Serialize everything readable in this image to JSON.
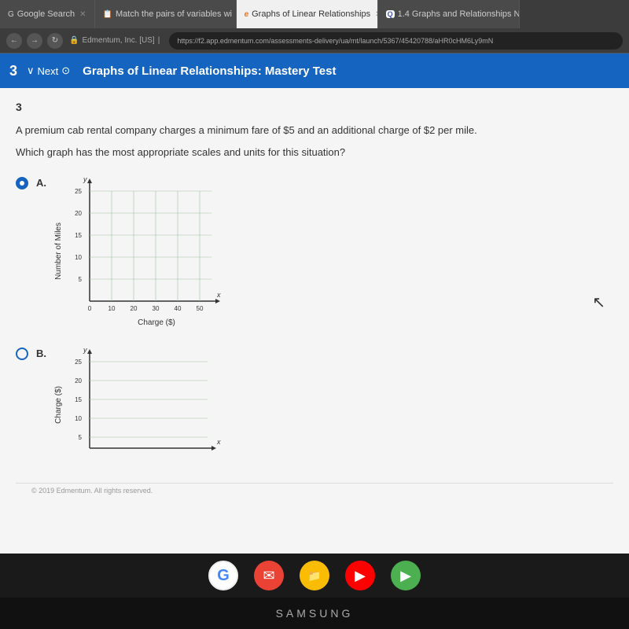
{
  "tabs": [
    {
      "id": "google-search",
      "label": "Google Search",
      "icon": "G",
      "active": false,
      "color": "#4a4a4a"
    },
    {
      "id": "match-pairs",
      "label": "Match the pairs of variables wi",
      "icon": "📋",
      "active": false,
      "color": "#4a4a4a"
    },
    {
      "id": "graphs-linear",
      "label": "Graphs of Linear Relationships",
      "icon": "e",
      "active": true,
      "color": "#f0f0f0"
    },
    {
      "id": "1-4-graphs",
      "label": "1.4 Graphs and Relationships N",
      "icon": "Q",
      "active": false,
      "color": "#4a4a4a"
    }
  ],
  "address_bar": {
    "lock_icon": "🔒",
    "site": "Edmentum, Inc. [US]",
    "separator": "|",
    "url": "https://f2.app.edmentum.com/assessments-delivery/ua/mt/launch/5367/45420788/aHR0cHM6Ly9mN"
  },
  "page_nav": {
    "question_num": "3",
    "chevron": "∨",
    "next_label": "Next",
    "next_icon": "⊙",
    "title": "Graphs of Linear Relationships: Mastery Test"
  },
  "question": {
    "number": "3",
    "text": "A premium cab rental company charges a minimum fare of $5 and an additional charge of $2 per mile.",
    "sub_text": "Which graph has the most appropriate scales and units for this situation?",
    "options": [
      {
        "id": "A",
        "selected": true,
        "y_axis_label": "Number of Miles",
        "x_axis_label": "Charge ($)",
        "y_label": "y",
        "x_label": "x",
        "y_max": 25,
        "y_ticks": [
          25,
          20,
          15,
          10,
          5
        ],
        "x_ticks": [
          0,
          10,
          20,
          30,
          40,
          50
        ]
      },
      {
        "id": "B",
        "selected": false,
        "y_axis_label": "Charge ($)",
        "x_axis_label": "",
        "y_label": "y",
        "x_label": "x",
        "y_max": 25,
        "y_ticks": [
          25,
          20,
          15,
          10,
          5
        ],
        "x_ticks": []
      }
    ]
  },
  "footer": {
    "text": "© 2019 Edmentum. All rights reserved."
  },
  "taskbar": {
    "icons": [
      "google",
      "gmail",
      "files",
      "youtube",
      "play"
    ]
  },
  "samsung": {
    "text": "SAMSUNG"
  }
}
